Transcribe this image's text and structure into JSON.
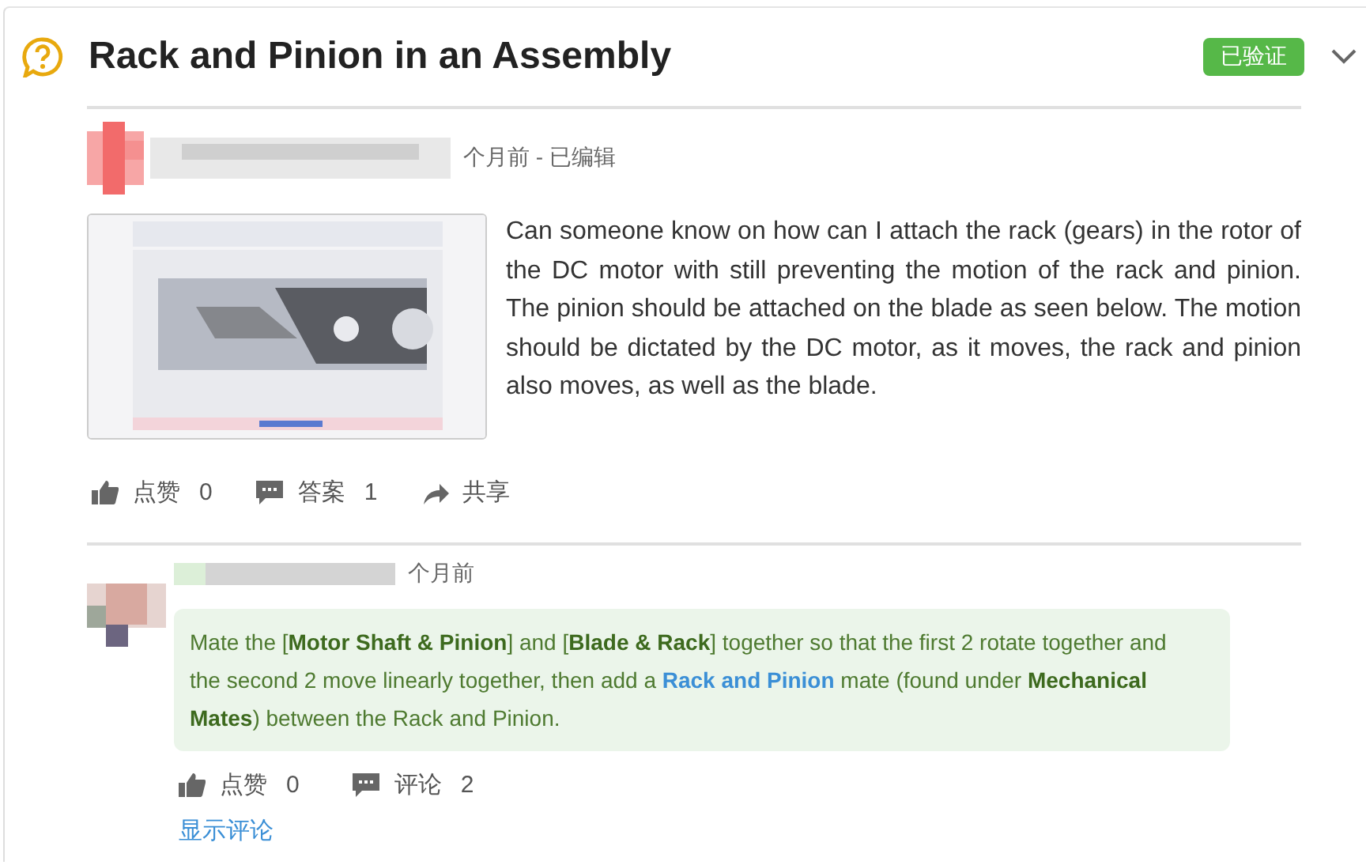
{
  "question": {
    "title": "Rack and Pinion in an Assembly",
    "badge": "已验证",
    "meta": "个月前 - 已编辑",
    "body": "Can someone know on how can I attach the rack (gears) in the rotor of the DC motor with still preventing the motion of the rack and pinion. The pinion should be attached on the blade as seen below. The motion should be dictated by the DC motor, as it moves, the rack and pinion also moves, as well as the blade.",
    "actions": [
      {
        "kind": "like",
        "label": "点赞",
        "count": "0"
      },
      {
        "kind": "comment",
        "label": "答案",
        "count": "1"
      },
      {
        "kind": "share",
        "label": "共享"
      }
    ]
  },
  "answer": {
    "meta": "个月前",
    "segments": [
      {
        "kind": "plain",
        "text": "Mate the ["
      },
      {
        "kind": "bold",
        "text": "Motor Shaft & Pinion"
      },
      {
        "kind": "plain",
        "text": "] and ["
      },
      {
        "kind": "bold",
        "text": "Blade & Rack"
      },
      {
        "kind": "plain",
        "text": "] together so that the first 2 rotate together and the second 2 move linearly together, then add a "
      },
      {
        "kind": "link",
        "text": "Rack and Pinion"
      },
      {
        "kind": "plain",
        "text": " mate (found under "
      },
      {
        "kind": "bold",
        "text": "Mechanical Mates"
      },
      {
        "kind": "plain",
        "text": ") between the Rack and Pinion."
      }
    ],
    "actions": [
      {
        "kind": "like",
        "label": "点赞",
        "count": "0"
      },
      {
        "kind": "comment",
        "label": "评论",
        "count": "2"
      }
    ],
    "show_comments": "显示评论"
  }
}
